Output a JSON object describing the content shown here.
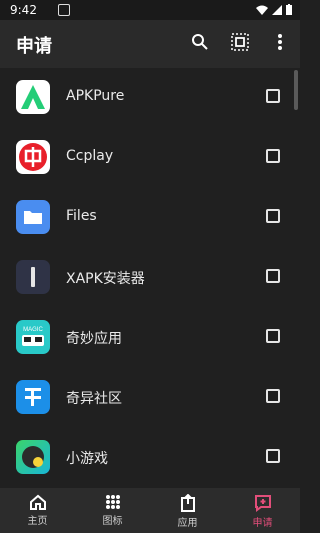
{
  "status_bar": {
    "time": "9:42"
  },
  "app_bar": {
    "title": "申请"
  },
  "apps": [
    {
      "name": "APKPure",
      "icon": "apkpure-icon"
    },
    {
      "name": "Ccplay",
      "icon": "ccplay-icon"
    },
    {
      "name": "Files",
      "icon": "files-icon"
    },
    {
      "name": "XAPK安装器",
      "icon": "xapk-icon"
    },
    {
      "name": "奇妙应用",
      "icon": "qimiao-icon"
    },
    {
      "name": "奇异社区",
      "icon": "qiyi-icon"
    },
    {
      "name": "小游戏",
      "icon": "minigame-icon"
    }
  ],
  "bottom_nav": {
    "items": [
      {
        "label": "主页",
        "icon": "home-icon"
      },
      {
        "label": "图标",
        "icon": "grid-icon"
      },
      {
        "label": "应用",
        "icon": "share-icon"
      },
      {
        "label": "申请",
        "icon": "request-icon"
      }
    ],
    "active_index": 3
  },
  "colors": {
    "accent": "#e24e7a",
    "background": "#202020",
    "appbar": "#2a2a2a"
  }
}
